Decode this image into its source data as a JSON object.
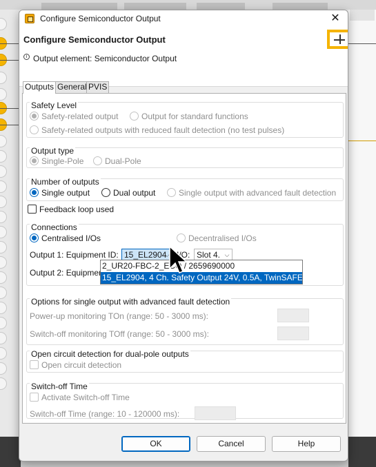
{
  "window": {
    "title": "Configure Semiconductor Output",
    "close_glyph": "✕"
  },
  "header": {
    "title": "Configure Semiconductor Output",
    "subtitle": "Output element: Semiconductor Output",
    "info_glyph": "i"
  },
  "tabs": [
    {
      "label": "Outputs",
      "active": true
    },
    {
      "label": "General",
      "active": false
    },
    {
      "label": "PVIS",
      "active": false
    }
  ],
  "safety_level": {
    "title": "Safety Level",
    "options": [
      {
        "label": "Safety-related output",
        "checked": true,
        "enabled": false
      },
      {
        "label": "Output for standard functions",
        "checked": false,
        "enabled": false
      },
      {
        "label": "Safety-related outputs with reduced fault detection (no test pulses)",
        "checked": false,
        "enabled": false
      }
    ]
  },
  "output_type": {
    "title": "Output type",
    "options": [
      {
        "label": "Single-Pole",
        "checked": true,
        "enabled": false
      },
      {
        "label": "Dual-Pole",
        "checked": false,
        "enabled": false
      }
    ]
  },
  "number_of_outputs": {
    "title": "Number of outputs",
    "options": [
      {
        "label": "Single output",
        "checked": true,
        "enabled": true
      },
      {
        "label": "Dual output",
        "checked": false,
        "enabled": true
      },
      {
        "label": "Single output with advanced fault detection",
        "checked": false,
        "enabled": false
      }
    ]
  },
  "feedback_loop": {
    "label": "Feedback loop used",
    "checked": false
  },
  "connections": {
    "title": "Connections",
    "options": [
      {
        "label": "Centralised I/Os",
        "checked": true,
        "enabled": true
      },
      {
        "label": "Decentralised I/Os",
        "checked": false,
        "enabled": false
      }
    ],
    "output1_label": "Output 1: Equipment ID:",
    "output1_value": "15_EL2904",
    "io_label": "I/O:",
    "io_value": "Slot 4.",
    "output2_label": "Output 2: Equipment ID:",
    "dropdown_options": [
      {
        "label": "2_UR20-FBC-2_ECO / 2659690000",
        "selected": false
      },
      {
        "label": "15_EL2904, 4 Ch. Safety Output 24V, 0.5A, TwinSAFE",
        "selected": true
      }
    ]
  },
  "advanced_fault": {
    "title": "Options for single output with advanced fault detection",
    "power_up_label": "Power-up monitoring TOn (range: 50 - 3000 ms):",
    "switch_off_label": "Switch-off monitoring TOff (range: 50 - 3000 ms):"
  },
  "open_circuit": {
    "title": "Open circuit detection for dual-pole outputs",
    "checkbox_label": "Open circuit detection"
  },
  "switch_off_time": {
    "title": "Switch-off Time",
    "checkbox_label": "Activate Switch-off Time",
    "range_label": "Switch-off Time (range: 10 - 120000 ms):"
  },
  "buttons": {
    "ok": "OK",
    "cancel": "Cancel",
    "help": "Help"
  },
  "colors": {
    "accent": "#0067c0",
    "selection_bg": "#0067c0",
    "brand_yellow": "#f5b400"
  },
  "icons": {
    "app": "app-icon",
    "close": "close-icon",
    "info": "info-icon",
    "header": "module-icon",
    "combo_arrow": "chevron-down-icon",
    "cursor": "mouse-pointer-icon"
  }
}
